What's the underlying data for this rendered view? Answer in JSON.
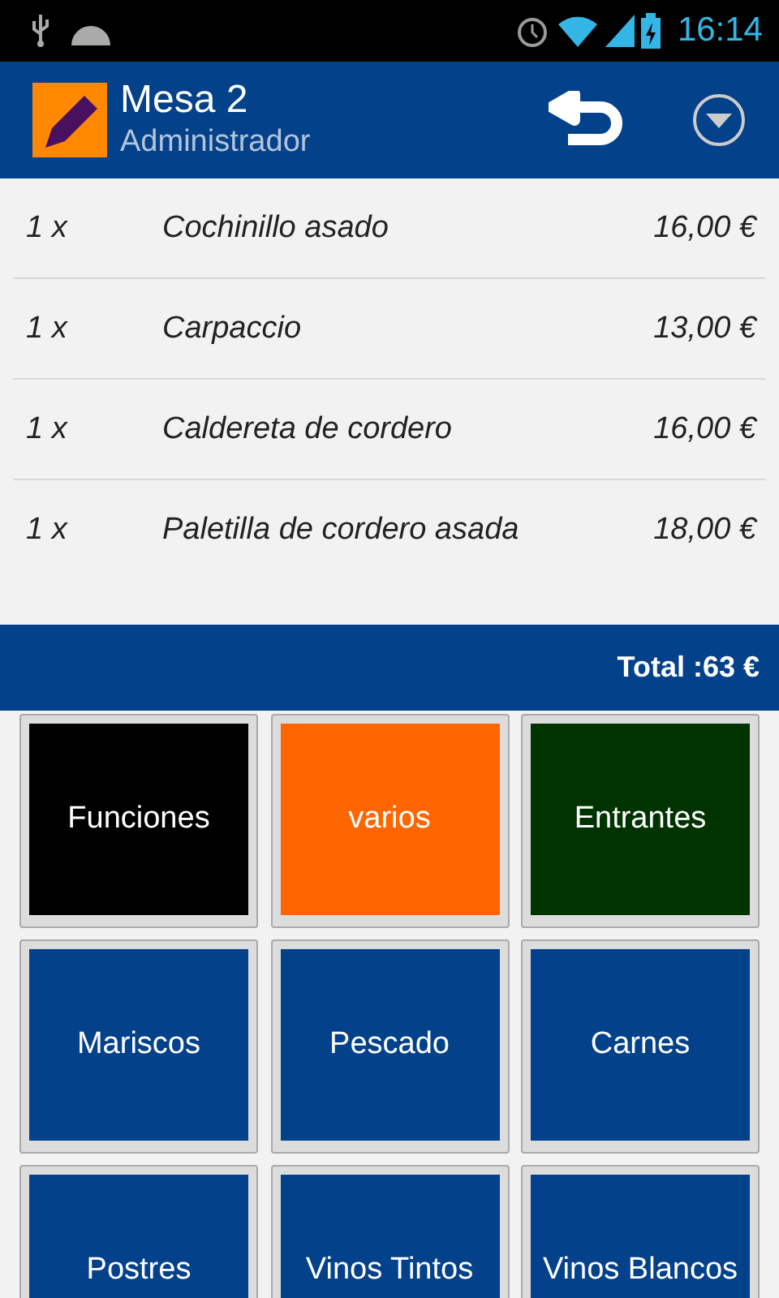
{
  "status_bar": {
    "time": "16:14"
  },
  "action_bar": {
    "title": "Mesa 2",
    "subtitle": "Administrador"
  },
  "order_items": [
    {
      "quantity": "1 x",
      "name": "Cochinillo asado",
      "price": "16,00 €"
    },
    {
      "quantity": "1 x",
      "name": "Carpaccio",
      "price": "13,00 €"
    },
    {
      "quantity": "1 x",
      "name": "Caldereta de cordero",
      "price": "16,00 €"
    },
    {
      "quantity": "1 x",
      "name": "Paletilla de cordero asada",
      "price": "18,00 €"
    }
  ],
  "total": "Total :63 €",
  "categories": [
    {
      "label": "Funciones",
      "color": "#000000"
    },
    {
      "label": "varios",
      "color": "#ff6600"
    },
    {
      "label": "Entrantes",
      "color": "#003300"
    },
    {
      "label": "Mariscos",
      "color": "#03418a"
    },
    {
      "label": "Pescado",
      "color": "#03418a"
    },
    {
      "label": "Carnes",
      "color": "#03418a"
    },
    {
      "label": "Postres",
      "color": "#03418a"
    },
    {
      "label": "Vinos Tintos",
      "color": "#03418a"
    },
    {
      "label": "Vinos Blancos",
      "color": "#03418a"
    }
  ]
}
